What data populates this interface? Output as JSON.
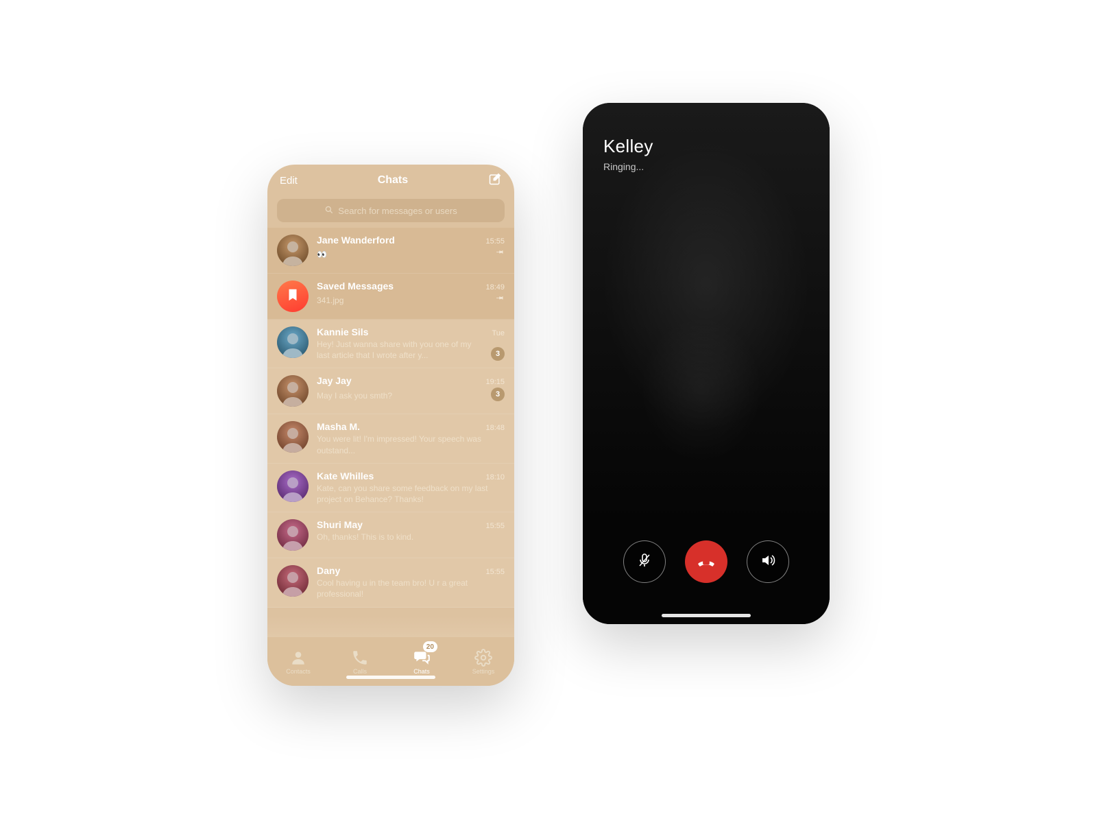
{
  "chats_phone": {
    "header": {
      "edit_label": "Edit",
      "title": "Chats"
    },
    "search": {
      "placeholder": "Search for messages or users"
    },
    "chats": [
      {
        "name": "Jane Wanderford",
        "preview": "👀",
        "time": "15:55",
        "pinned": true
      },
      {
        "name": "Saved Messages",
        "preview": "341.jpg",
        "time": "18:49",
        "pinned": true,
        "saved": true
      },
      {
        "name": "Kannie Sils",
        "preview": "Hey! Just wanna share with you one of my last article that I wrote after y...",
        "time": "Tue",
        "unread": "3"
      },
      {
        "name": "Jay Jay",
        "preview": "May I ask you smth?",
        "time": "19:15",
        "unread": "3"
      },
      {
        "name": "Masha M.",
        "preview": "You were lit!\nI'm impressed! Your speech was outstand...",
        "time": "18:48"
      },
      {
        "name": "Kate Whilles",
        "preview": "Kate, can you share some feedback on my last project on Behance? Thanks!",
        "time": "18:10"
      },
      {
        "name": "Shuri May",
        "preview": "Oh, thanks! This is to kind.",
        "time": "15:55"
      },
      {
        "name": "Dany",
        "preview": "Cool having u in the team bro!\nU r a great professional!",
        "time": "15:55"
      }
    ],
    "tabs": {
      "contacts": "Contacts",
      "calls": "Calls",
      "chats": "Chats",
      "settings": "Settings",
      "chats_badge": "20"
    }
  },
  "call_phone": {
    "name": "Kelley",
    "status": "Ringing..."
  }
}
